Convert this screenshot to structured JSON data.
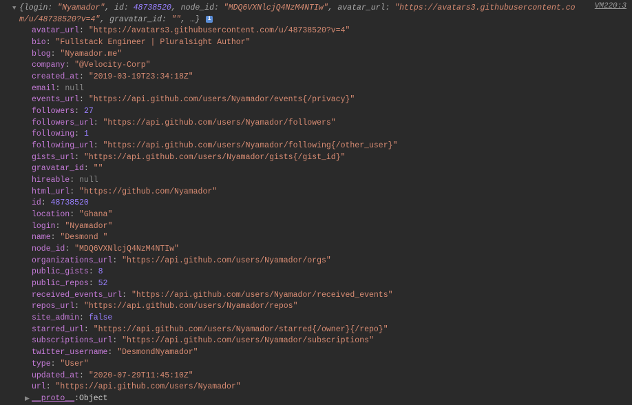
{
  "source_link": "VM220:3",
  "summary_prefix": "{login: ",
  "summary_login": "\"Nyamador\"",
  "summary_mid1": ", id: ",
  "summary_id": "48738520",
  "summary_mid2": ", node_id: ",
  "summary_node_id": "\"MDQ6VXNlcjQ4NzM4NTIw\"",
  "summary_mid3": ", avatar_url: ",
  "summary_avatar": "\"https://avatars3.githubusercontent.com/u/48738520?v=4\"",
  "summary_mid4": ", gravatar_id: ",
  "summary_gravatar": "\"\"",
  "summary_suffix": ", …}",
  "info_badge": "i",
  "props": [
    {
      "key": "avatar_url",
      "type": "string",
      "val": "\"https://avatars3.githubusercontent.com/u/48738520?v=4\""
    },
    {
      "key": "bio",
      "type": "string",
      "val": "\"Fullstack Engineer | Pluralsight Author\""
    },
    {
      "key": "blog",
      "type": "string",
      "val": "\"Nyamador.me\""
    },
    {
      "key": "company",
      "type": "string",
      "val": "\"@Velocity-Corp\""
    },
    {
      "key": "created_at",
      "type": "string",
      "val": "\"2019-03-19T23:34:18Z\""
    },
    {
      "key": "email",
      "type": "null",
      "val": "null"
    },
    {
      "key": "events_url",
      "type": "string",
      "val": "\"https://api.github.com/users/Nyamador/events{/privacy}\""
    },
    {
      "key": "followers",
      "type": "number",
      "val": "27"
    },
    {
      "key": "followers_url",
      "type": "string",
      "val": "\"https://api.github.com/users/Nyamador/followers\""
    },
    {
      "key": "following",
      "type": "number",
      "val": "1"
    },
    {
      "key": "following_url",
      "type": "string",
      "val": "\"https://api.github.com/users/Nyamador/following{/other_user}\""
    },
    {
      "key": "gists_url",
      "type": "string",
      "val": "\"https://api.github.com/users/Nyamador/gists{/gist_id}\""
    },
    {
      "key": "gravatar_id",
      "type": "string",
      "val": "\"\""
    },
    {
      "key": "hireable",
      "type": "null",
      "val": "null"
    },
    {
      "key": "html_url",
      "type": "string",
      "val": "\"https://github.com/Nyamador\""
    },
    {
      "key": "id",
      "type": "number",
      "val": "48738520"
    },
    {
      "key": "location",
      "type": "string",
      "val": "\"Ghana\""
    },
    {
      "key": "login",
      "type": "string",
      "val": "\"Nyamador\""
    },
    {
      "key": "name",
      "type": "string",
      "val": "\"Desmond \""
    },
    {
      "key": "node_id",
      "type": "string",
      "val": "\"MDQ6VXNlcjQ4NzM4NTIw\""
    },
    {
      "key": "organizations_url",
      "type": "string",
      "val": "\"https://api.github.com/users/Nyamador/orgs\""
    },
    {
      "key": "public_gists",
      "type": "number",
      "val": "8"
    },
    {
      "key": "public_repos",
      "type": "number",
      "val": "52"
    },
    {
      "key": "received_events_url",
      "type": "string",
      "val": "\"https://api.github.com/users/Nyamador/received_events\""
    },
    {
      "key": "repos_url",
      "type": "string",
      "val": "\"https://api.github.com/users/Nyamador/repos\""
    },
    {
      "key": "site_admin",
      "type": "bool",
      "val": "false"
    },
    {
      "key": "starred_url",
      "type": "string",
      "val": "\"https://api.github.com/users/Nyamador/starred{/owner}{/repo}\""
    },
    {
      "key": "subscriptions_url",
      "type": "string",
      "val": "\"https://api.github.com/users/Nyamador/subscriptions\""
    },
    {
      "key": "twitter_username",
      "type": "string",
      "val": "\"DesmondNyamador\""
    },
    {
      "key": "type",
      "type": "string",
      "val": "\"User\""
    },
    {
      "key": "updated_at",
      "type": "string",
      "val": "\"2020-07-29T11:45:10Z\""
    },
    {
      "key": "url",
      "type": "string",
      "val": "\"https://api.github.com/users/Nyamador\""
    }
  ],
  "proto_key": "__proto__",
  "proto_val": "Object"
}
